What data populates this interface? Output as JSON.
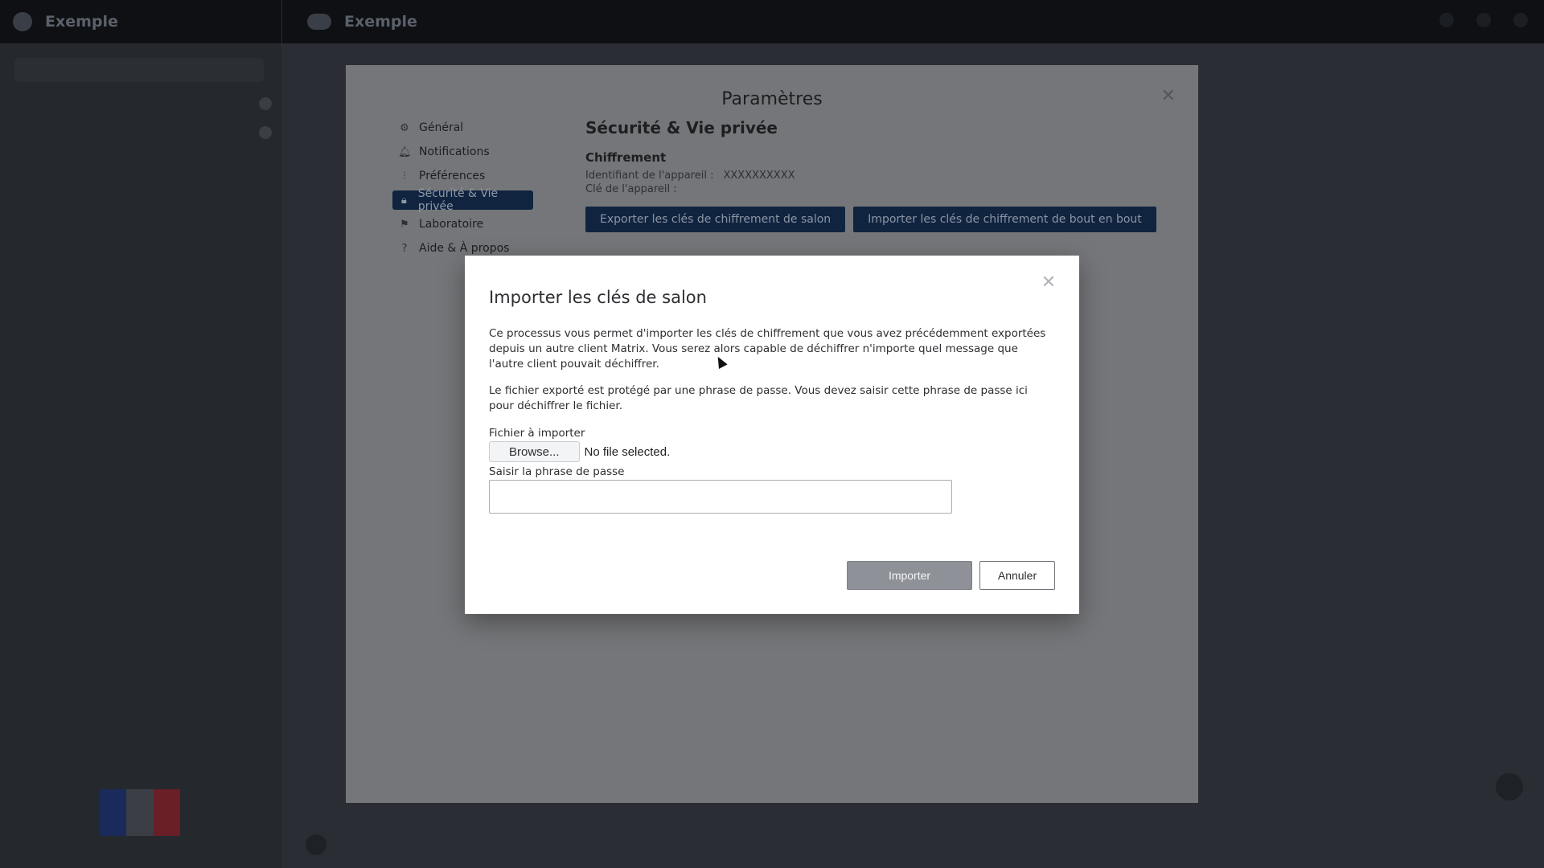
{
  "topbar": {
    "workspace1": "Exemple",
    "workspace2": "Exemple"
  },
  "settings": {
    "title": "Paramètres",
    "nav": [
      {
        "label": "Général",
        "icon": "gear-icon"
      },
      {
        "label": "Notifications",
        "icon": "bell-icon"
      },
      {
        "label": "Préférences",
        "icon": "sliders-icon"
      },
      {
        "label": "Sécurité & Vie privée",
        "icon": "lock-icon",
        "active": true
      },
      {
        "label": "Laboratoire",
        "icon": "flag-icon"
      },
      {
        "label": "Aide & À propos",
        "icon": "help-icon"
      }
    ],
    "section_title": "Sécurité & Vie privée",
    "subsection_title": "Chiffrement",
    "device_id_label": "Identifiant de l'appareil :",
    "device_id_value": "XXXXXXXXXX",
    "device_key_label": "Clé de l'appareil :",
    "export_button": "Exporter les clés de chiffrement de salon",
    "import_button": "Importer les clés de chiffrement de bout en bout"
  },
  "modal": {
    "title": "Importer les clés de salon",
    "paragraph1": "Ce processus vous permet d'importer les clés de chiffrement que vous avez précédemment exportées depuis un autre client Matrix. Vous serez alors capable de déchiffrer n'importe quel message que l'autre client pouvait déchiffrer.",
    "paragraph2": "Le fichier exporté est protégé par une phrase de passe. Vous devez saisir cette phrase de passe ici pour déchiffrer le fichier.",
    "file_label": "Fichier à importer",
    "browse_label": "Browse...",
    "file_status": "No file selected.",
    "passphrase_label": "Saisir la phrase de passe",
    "passphrase_value": "",
    "import_label": "Importer",
    "cancel_label": "Annuler"
  },
  "colors": {
    "accent": "#102440",
    "overlay": "#2a2d33"
  }
}
